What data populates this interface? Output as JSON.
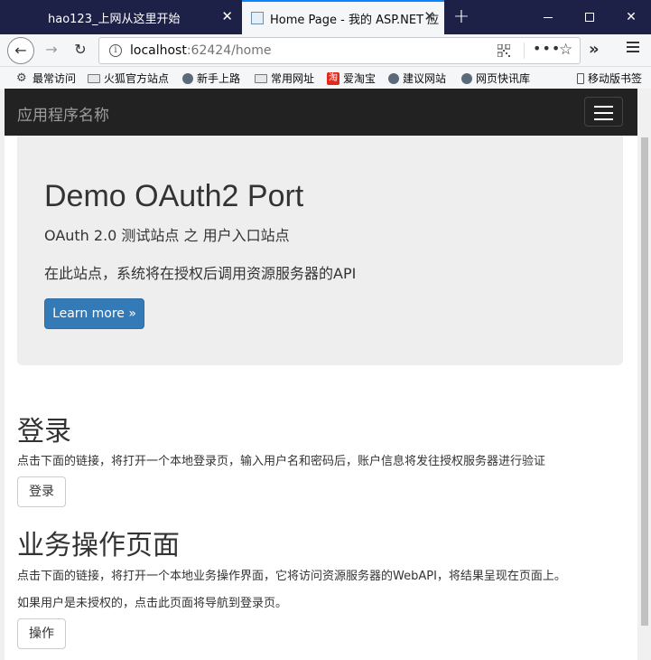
{
  "browser": {
    "tabs": [
      {
        "title": "hao123_上网从这里开始",
        "active": false
      },
      {
        "title": "Home Page - 我的 ASP.NET 应",
        "active": true
      }
    ],
    "window_controls": {
      "minimize": "minimize",
      "maximize": "maximize",
      "close": "✕"
    },
    "url": {
      "host": "localhost",
      "rest": ":62424/home"
    },
    "bookmarks": [
      {
        "label": "最常访问",
        "icon": "gear-icon"
      },
      {
        "label": "火狐官方站点",
        "icon": "folder-icon"
      },
      {
        "label": "新手上路",
        "icon": "globe-icon"
      },
      {
        "label": "常用网址",
        "icon": "folder-icon"
      },
      {
        "label": "爱淘宝",
        "icon": "taobao-icon"
      },
      {
        "label": "建议网站",
        "icon": "globe-icon"
      },
      {
        "label": "网页快讯库",
        "icon": "globe-icon"
      },
      {
        "label": "移动版书签",
        "icon": "phone-icon"
      }
    ]
  },
  "page": {
    "brand": "应用程序名称",
    "jumbotron": {
      "title": "Demo OAuth2 Port",
      "subtitle": "OAuth 2.0 测试站点 之 用户入口站点",
      "description": "在此站点，系统将在授权后调用资源服务器的API",
      "button": "Learn more »"
    },
    "login": {
      "title": "登录",
      "text": "点击下面的链接，将打开一个本地登录页，输入用户名和密码后，账户信息将发往授权服务器进行验证",
      "button": "登录"
    },
    "operation": {
      "title": "业务操作页面",
      "text1": "点击下面的链接，将打开一个本地业务操作界面，它将访问资源服务器的WebAPI，将结果呈现在页面上。",
      "text2": "如果用户是未授权的，点击此页面将导航到登录页。",
      "button": "操作"
    }
  },
  "colors": {
    "titlebar": "#1e2147",
    "accent_tab": "#0a84ff",
    "navbar_bg": "#222222",
    "jumbotron_bg": "#eeeeee",
    "primary_button": "#337ab7"
  }
}
